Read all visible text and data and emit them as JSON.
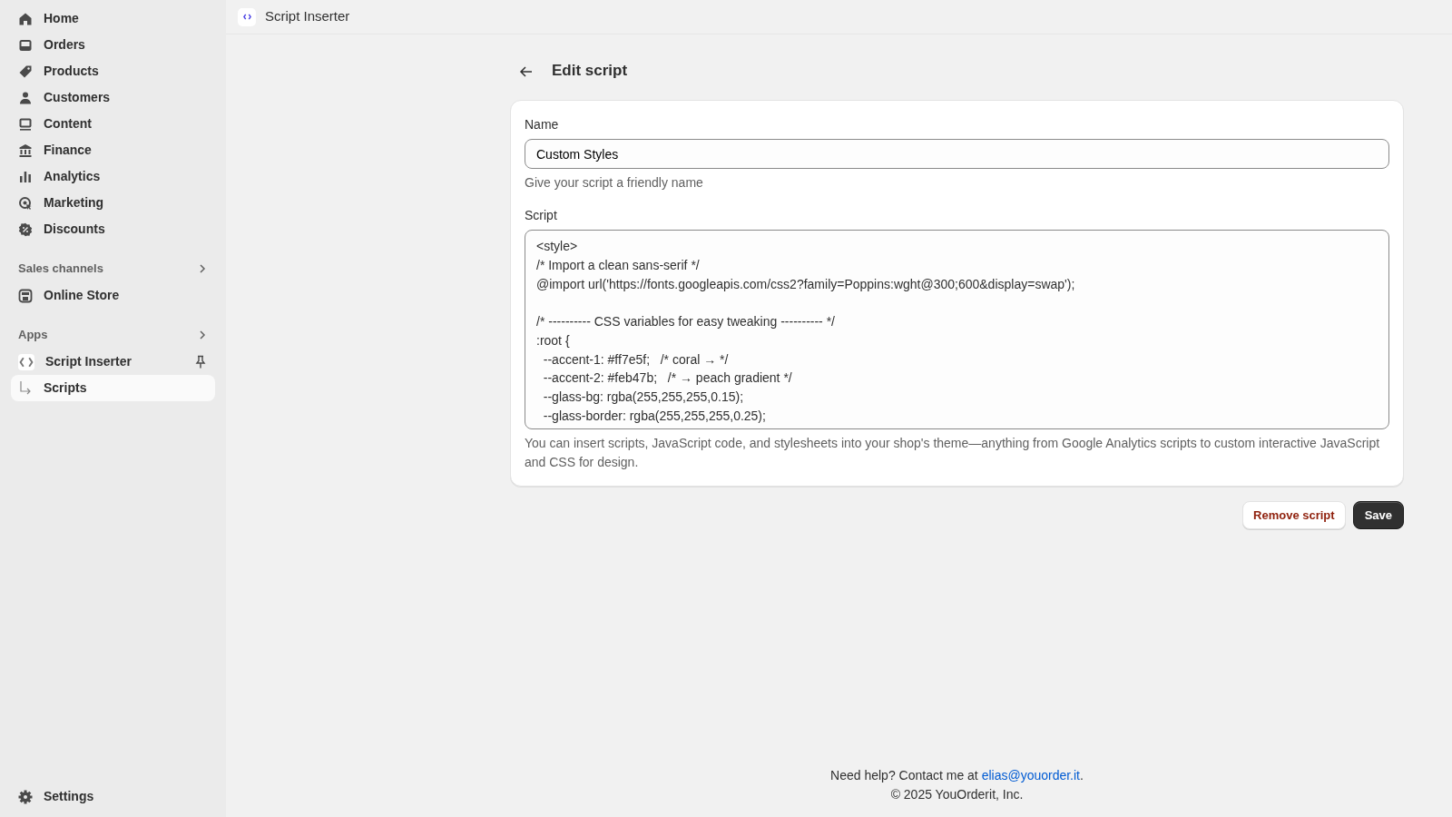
{
  "sidebar": {
    "items": [
      {
        "label": "Home",
        "selected": false
      },
      {
        "label": "Orders",
        "selected": false
      },
      {
        "label": "Products",
        "selected": false
      },
      {
        "label": "Customers",
        "selected": false
      },
      {
        "label": "Content",
        "selected": false
      },
      {
        "label": "Finance",
        "selected": false
      },
      {
        "label": "Analytics",
        "selected": false
      },
      {
        "label": "Marketing",
        "selected": false
      },
      {
        "label": "Discounts",
        "selected": false
      }
    ],
    "sections": [
      {
        "title": "Sales channels",
        "items": [
          {
            "label": "Online Store",
            "selected": false
          }
        ]
      },
      {
        "title": "Apps",
        "items": [
          {
            "label": "Script Inserter",
            "selected": false,
            "pinned": true,
            "children": [
              {
                "label": "Scripts",
                "selected": true
              }
            ]
          }
        ]
      }
    ],
    "footer_item": {
      "label": "Settings",
      "selected": false
    }
  },
  "top_bar": {
    "title": "Script Inserter"
  },
  "page": {
    "title": "Edit script",
    "name_field": {
      "label": "Name",
      "value": "Custom Styles",
      "help": "Give your script a friendly name"
    },
    "script_field": {
      "label": "Script",
      "value": "<style>\n/* Import a clean sans-serif */\n@import url('https://fonts.googleapis.com/css2?family=Poppins:wght@300;600&display=swap');\n\n/* ---------- CSS variables for easy tweaking ---------- */\n:root {\n  --accent-1: #ff7e5f;   /* coral → */\n  --accent-2: #feb47b;   /* → peach gradient */\n  --glass-bg: rgba(255,255,255,0.15);\n  --glass-border: rgba(255,255,255,0.25);",
      "help": "You can insert scripts, JavaScript code, and stylesheets into your shop's theme—anything from Google Analytics scripts to custom interactive JavaScript and CSS for design."
    },
    "buttons": [
      {
        "label": "Remove script",
        "kind": "critical"
      },
      {
        "label": "Save",
        "kind": "primary"
      }
    ]
  },
  "footer": {
    "help_text": "Need help? Contact me at ",
    "email": "elias@youorder.it",
    "help_end": ".",
    "copyright": "© 2025 YouOrderit, Inc."
  }
}
